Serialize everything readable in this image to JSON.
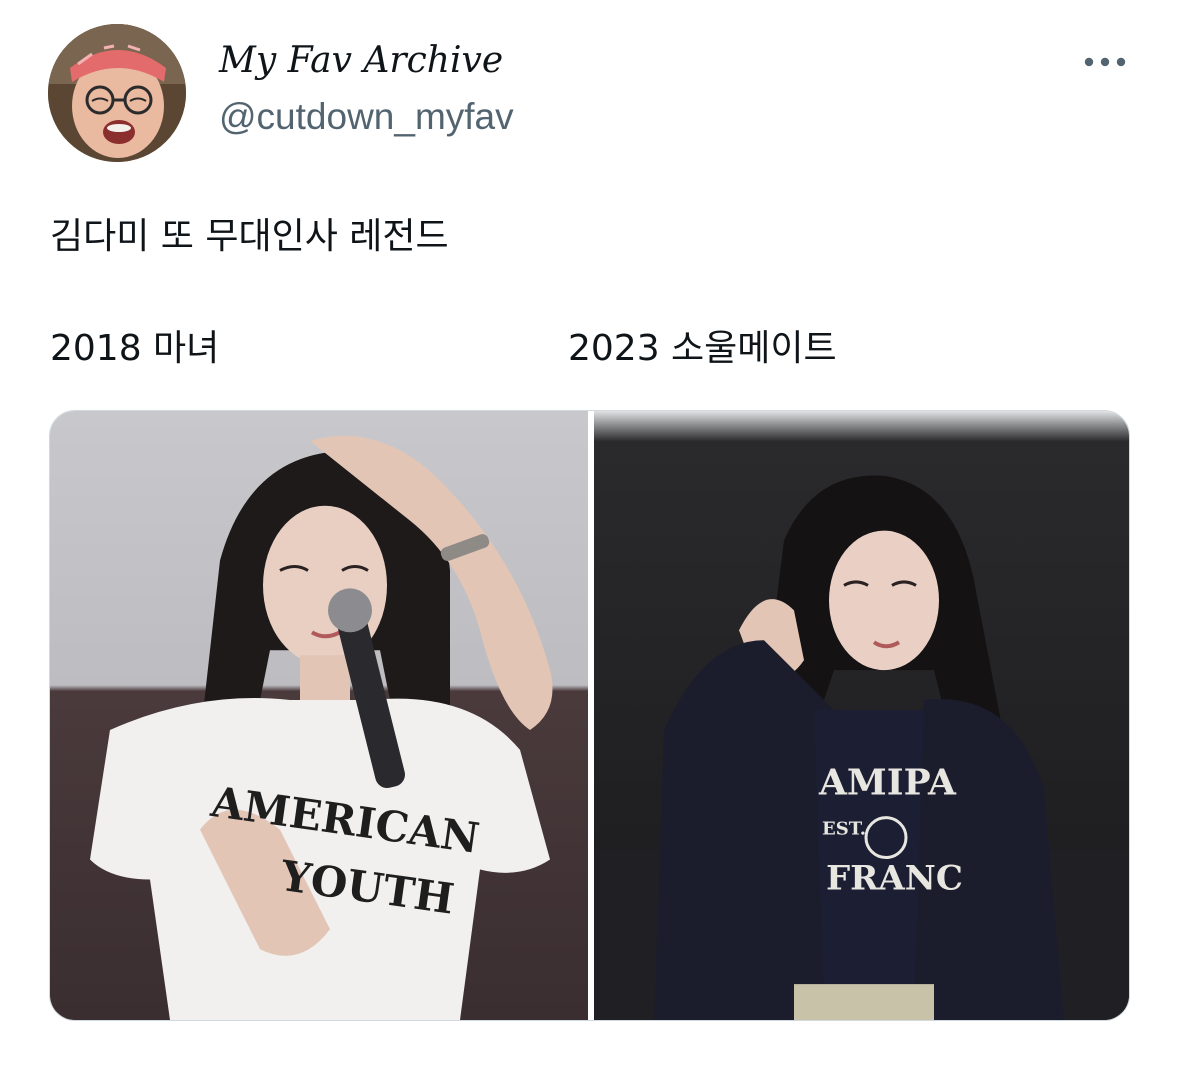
{
  "author": {
    "display_name": "My Fav Archive",
    "handle": "@cutdown_myfav",
    "avatar_icon": "profile-avatar"
  },
  "menu": {
    "more_icon": "more-horizontal-icon"
  },
  "tweet": {
    "text": "김다미 또 무대인사 레전드",
    "captions": {
      "left": "2018 마녀",
      "right": "2023 소울메이트"
    }
  },
  "media": {
    "photos": [
      {
        "shirt_lines": [
          "AMERICAN",
          "YOUTH"
        ]
      },
      {
        "shirt_lines": [
          "AMIPA",
          "EST.",
          "FRANC"
        ]
      }
    ]
  },
  "colors": {
    "text_primary": "#0f1419",
    "text_secondary": "#536471",
    "border": "#cfd9de"
  }
}
